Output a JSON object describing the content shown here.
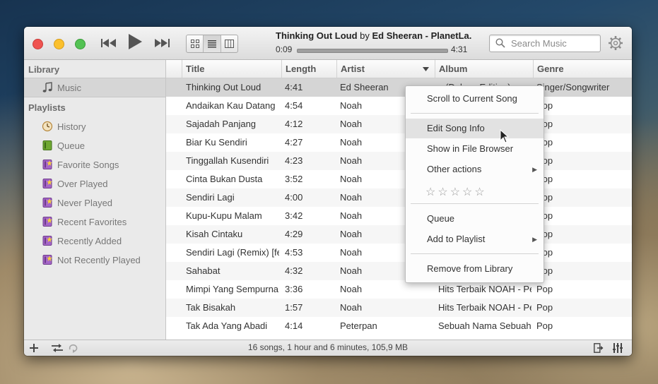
{
  "toolbar": {
    "now_playing": {
      "title": "Thinking Out Loud",
      "by": " by ",
      "artist": "Ed Sheeran",
      "sep": " - ",
      "album": "PlanetLa..."
    },
    "elapsed": "0:09",
    "total": "4:31",
    "progress_fraction": 0.04,
    "search_placeholder": "Search Music"
  },
  "sidebar": {
    "library_heading": "Library",
    "library_items": [
      {
        "label": "Music",
        "icon": "music-note-icon"
      }
    ],
    "playlists_heading": "Playlists",
    "playlists": [
      {
        "label": "History",
        "icon": "history-icon"
      },
      {
        "label": "Queue",
        "icon": "queue-icon"
      },
      {
        "label": "Favorite Songs",
        "icon": "smart-playlist-icon"
      },
      {
        "label": "Over Played",
        "icon": "smart-playlist-icon"
      },
      {
        "label": "Never Played",
        "icon": "smart-playlist-icon"
      },
      {
        "label": "Recent Favorites",
        "icon": "smart-playlist-icon"
      },
      {
        "label": "Recently Added",
        "icon": "smart-playlist-icon"
      },
      {
        "label": "Not Recently Played",
        "icon": "smart-playlist-icon"
      }
    ]
  },
  "table": {
    "columns": [
      "Title",
      "Length",
      "Artist",
      "Album",
      "Genre"
    ],
    "rows": [
      {
        "title": "Thinking Out Loud",
        "length": "4:41",
        "artist": "Ed Sheeran",
        "album": "x (Deluxe Edition)",
        "genre": "Singer/Songwriter"
      },
      {
        "title": "Andaikan Kau Datang",
        "length": "4:54",
        "artist": "Noah",
        "album": "",
        "genre": "Pop"
      },
      {
        "title": "Sajadah Panjang",
        "length": "4:12",
        "artist": "Noah",
        "album": "",
        "genre": "Pop"
      },
      {
        "title": "Biar Ku Sendiri",
        "length": "4:27",
        "artist": "Noah",
        "album": "",
        "genre": "Pop"
      },
      {
        "title": "Tinggallah Kusendiri",
        "length": "4:23",
        "artist": "Noah",
        "album": "",
        "genre": "Pop"
      },
      {
        "title": "Cinta Bukan Dusta",
        "length": "3:52",
        "artist": "Noah",
        "album": "",
        "genre": "Pop"
      },
      {
        "title": "Sendiri Lagi",
        "length": "4:00",
        "artist": "Noah",
        "album": "",
        "genre": "Pop"
      },
      {
        "title": "Kupu-Kupu Malam",
        "length": "3:42",
        "artist": "Noah",
        "album": "",
        "genre": "Pop"
      },
      {
        "title": "Kisah Cintaku",
        "length": "4:29",
        "artist": "Noah",
        "album": "",
        "genre": "Pop"
      },
      {
        "title": "Sendiri Lagi (Remix) [feat. Maia Estianty]",
        "length": "4:53",
        "artist": "Noah",
        "album": "",
        "genre": "Pop"
      },
      {
        "title": "Sahabat",
        "length": "4:32",
        "artist": "Noah",
        "album": "",
        "genre": "Pop"
      },
      {
        "title": "Mimpi Yang Sempurna",
        "length": "3:36",
        "artist": "Noah",
        "album": "Hits Terbaik NOAH - Pet",
        "genre": "Pop"
      },
      {
        "title": "Tak Bisakah",
        "length": "1:57",
        "artist": "Noah",
        "album": "Hits Terbaik NOAH - Pet",
        "genre": "Pop"
      },
      {
        "title": "Tak Ada Yang Abadi",
        "length": "4:14",
        "artist": "Peterpan",
        "album": "Sebuah Nama Sebuah Cerita",
        "genre": "Pop"
      }
    ]
  },
  "context_menu": {
    "items": [
      {
        "label": "Scroll to Current Song"
      },
      {
        "label": "Edit Song Info"
      },
      {
        "label": "Show in File Browser"
      },
      {
        "label": "Other actions"
      },
      {
        "label": "Queue"
      },
      {
        "label": "Add to Playlist"
      },
      {
        "label": "Remove from Library"
      }
    ],
    "rating_max": 5
  },
  "statusbar": {
    "text": "16 songs, 1 hour and 6 minutes, 105,9 MB"
  }
}
